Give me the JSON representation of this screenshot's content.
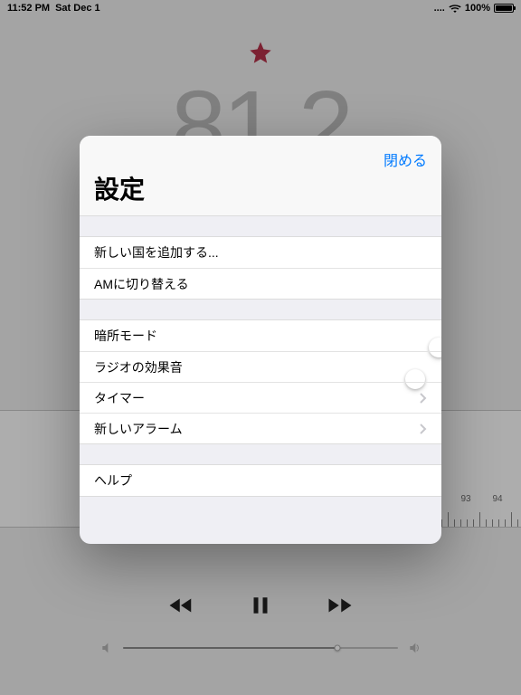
{
  "status": {
    "time": "11:52 PM",
    "date": "Sat Dec 1",
    "battery_pct": "100%"
  },
  "app": {
    "frequency": "81.2",
    "dial_labels": [
      "93",
      "94"
    ],
    "controls": {
      "prev": "rewind-icon",
      "playpause": "pause-icon",
      "next": "fastforward-icon"
    }
  },
  "modal": {
    "close_label": "閉める",
    "title": "設定",
    "group1": {
      "add_country": "新しい国を追加する...",
      "switch_am": "AMに切り替える"
    },
    "group2": {
      "dark_mode": "暗所モード",
      "dark_mode_on": false,
      "sound_fx": "ラジオの効果音",
      "sound_fx_on": true,
      "timer": "タイマー",
      "new_alarm": "新しいアラーム"
    },
    "group3": {
      "help": "ヘルプ"
    }
  }
}
